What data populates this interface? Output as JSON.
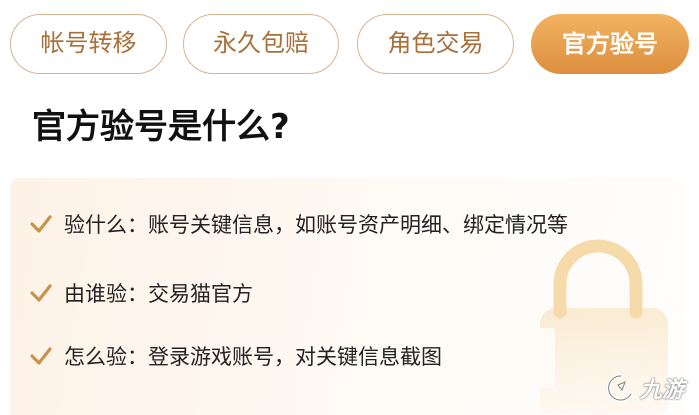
{
  "tabs": [
    {
      "label": "帐号转移",
      "active": false
    },
    {
      "label": "永久包赔",
      "active": false
    },
    {
      "label": "角色交易",
      "active": false
    },
    {
      "label": "官方验号",
      "active": true
    }
  ],
  "heading": "官方验号是什么?",
  "items": [
    {
      "text": "验什么：账号关键信息，如账号资产明细、绑定情况等"
    },
    {
      "text": "由谁验：交易猫官方"
    },
    {
      "text": "怎么验：登录游戏账号，对关键信息截图"
    }
  ],
  "icons": {
    "check": "checkmark-icon",
    "background": "padlock-icon",
    "watermark": "logo-icon"
  },
  "watermark": {
    "text": "九游"
  },
  "colors": {
    "accent": "#dc8f3f",
    "tab_text": "#a8703b",
    "tab_border": "#d9b48f",
    "panel_bg": "#fdf2e6"
  }
}
